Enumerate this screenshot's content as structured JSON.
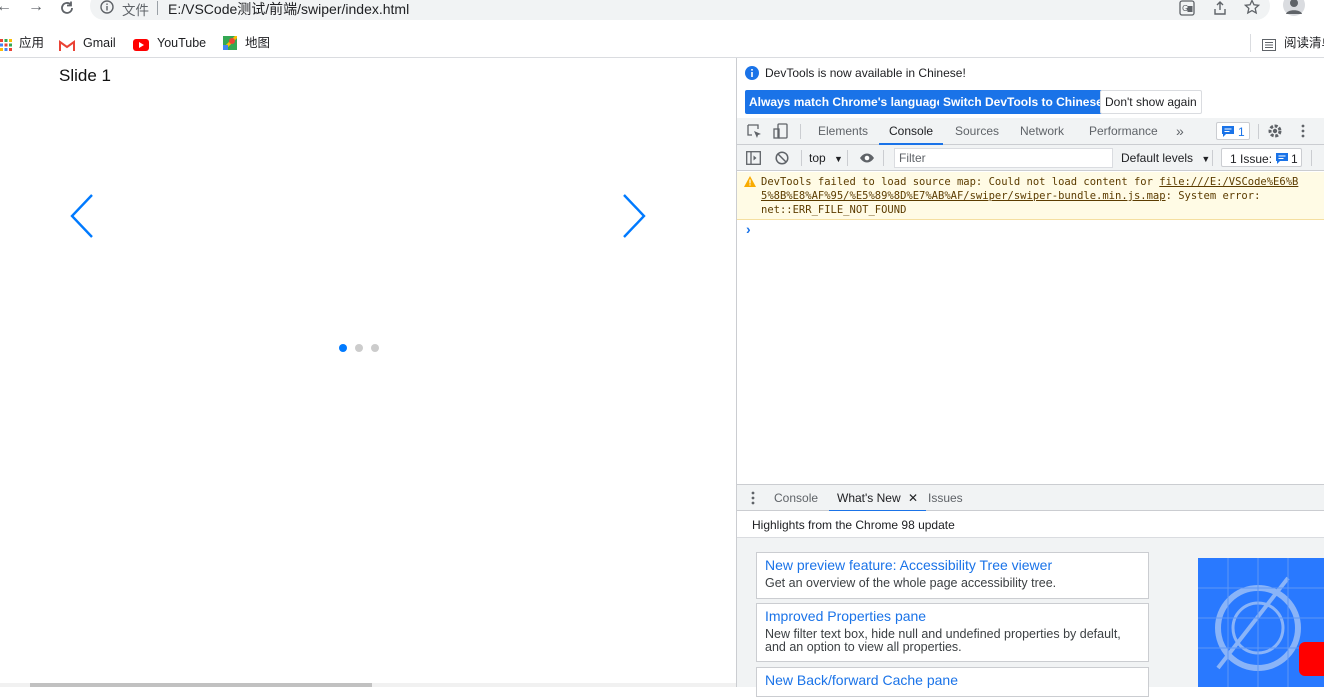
{
  "browser": {
    "address_prefix": "文件",
    "url": "E:/VSCode测试/前端/swiper/index.html",
    "bookmarks": [
      {
        "label": "应用",
        "icon": "apps-grid-icon"
      },
      {
        "label": "Gmail",
        "icon": "gmail-icon"
      },
      {
        "label": "YouTube",
        "icon": "youtube-icon"
      },
      {
        "label": "地图",
        "icon": "maps-icon"
      }
    ],
    "reading_list_label": "阅读清单"
  },
  "page": {
    "slide_title": "Slide 1",
    "pagination": {
      "total": 3,
      "active": 0
    },
    "colors": {
      "swiper_accent": "#007aff",
      "inactive_dot": "#cccccc"
    }
  },
  "devtools": {
    "banner": {
      "message": "DevTools is now available in Chinese!",
      "always_match": "Always match Chrome's language",
      "switch": "Switch DevTools to Chinese",
      "dont_show": "Don't show again"
    },
    "tabs": [
      "Elements",
      "Console",
      "Sources",
      "Network",
      "Performance"
    ],
    "active_tab": "Console",
    "message_count": "1",
    "console": {
      "context": "top",
      "filter_placeholder": "Filter",
      "levels": "Default levels",
      "issues": "1 Issue:",
      "issues_count": "1",
      "warning": {
        "line1_prefix": "DevTools failed to load source map: Could not load content for ",
        "line1_link": "file:///E:/VSCode%E6%B",
        "line2_link": "5%8B%E8%AF%95/%E5%89%8D%E7%AB%AF/swiper/swiper-bundle.min.js.map",
        "line2_suffix": ": System error:",
        "line3": "net::ERR_FILE_NOT_FOUND"
      },
      "prompt": "›"
    },
    "drawer": {
      "tabs": [
        "Console",
        "What's New",
        "Issues"
      ],
      "active_tab": "What's New",
      "highlights": "Highlights from the Chrome 98 update",
      "cards": [
        {
          "title": "New preview feature: Accessibility Tree viewer",
          "desc": "Get an overview of the whole page accessibility tree."
        },
        {
          "title": "Improved Properties pane",
          "desc": "New filter text box, hide null and undefined properties by default, and an option to view all properties."
        },
        {
          "title": "New Back/forward Cache pane",
          "desc": ""
        }
      ]
    },
    "colors": {
      "accent": "#1a73e8",
      "warning_bg": "#fffbe5",
      "warning_icon": "#f9ab00"
    }
  }
}
